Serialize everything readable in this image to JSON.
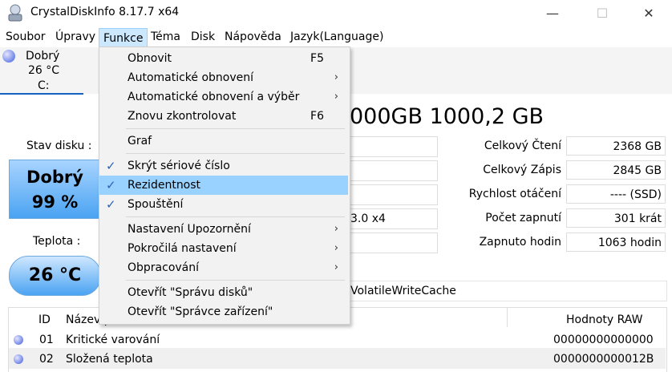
{
  "window": {
    "title": "CrystalDiskInfo 8.17.7 x64",
    "minimize": "—",
    "maximize": "☐",
    "close": "✕"
  },
  "menubar": {
    "items": [
      "Soubor",
      "Úpravy",
      "Funkce",
      "Téma",
      "Disk",
      "Nápověda",
      "Jazyk(Language)"
    ]
  },
  "disk_tab": {
    "status": "Dobrý",
    "temp": "26 °C",
    "drive": "C:"
  },
  "main": {
    "title_fragment": "000GB 1000,2 GB",
    "health_label": "Stav disku :",
    "health_status": "Dobrý",
    "health_percent": "99 %",
    "temp_label": "Teplota :",
    "temp_value": "26 °C",
    "interface_fragment": "3.0 x4",
    "features_fragment": "VolatileWriteCache",
    "stats": [
      {
        "label": "Celkový Čtení",
        "value": "2368 GB"
      },
      {
        "label": "Celkový Zápis",
        "value": "2845 GB"
      },
      {
        "label": "Rychlost otáčení",
        "value": "---- (SSD)"
      },
      {
        "label": "Počet zapnutí",
        "value": "301 krát"
      },
      {
        "label": "Zapnuto hodin",
        "value": "1063 hodin"
      }
    ]
  },
  "table": {
    "headers": [
      "ID",
      "Název parametru",
      "Hodnoty RAW"
    ],
    "rows": [
      {
        "id": "01",
        "name": "Kritické varování",
        "raw": "00000000000000"
      },
      {
        "id": "02",
        "name": "Složená teplota",
        "raw": "0000000000012B"
      }
    ]
  },
  "popup": {
    "items": [
      {
        "label": "Obnovit",
        "shortcut": "F5"
      },
      {
        "label": "Automatické obnovení",
        "submenu": "›"
      },
      {
        "label": "Automatické obnovení a výběr",
        "submenu": "›"
      },
      {
        "label": "Znovu zkontrolovat",
        "shortcut": "F6"
      },
      {
        "label": "Graf"
      },
      {
        "label": "Skrýt sériové číslo",
        "check": "✓"
      },
      {
        "label": "Rezidentnost",
        "check": "✓"
      },
      {
        "label": "Spouštění",
        "check": "✓"
      },
      {
        "label": "Nastavení Upozornění",
        "submenu": "›"
      },
      {
        "label": "Pokročilá nastavení",
        "submenu": "›"
      },
      {
        "label": "Obpracování",
        "submenu": "›"
      },
      {
        "label": "Otevřít \"Správu disků\""
      },
      {
        "label": "Otevřít \"Správce zařízení\""
      }
    ]
  }
}
